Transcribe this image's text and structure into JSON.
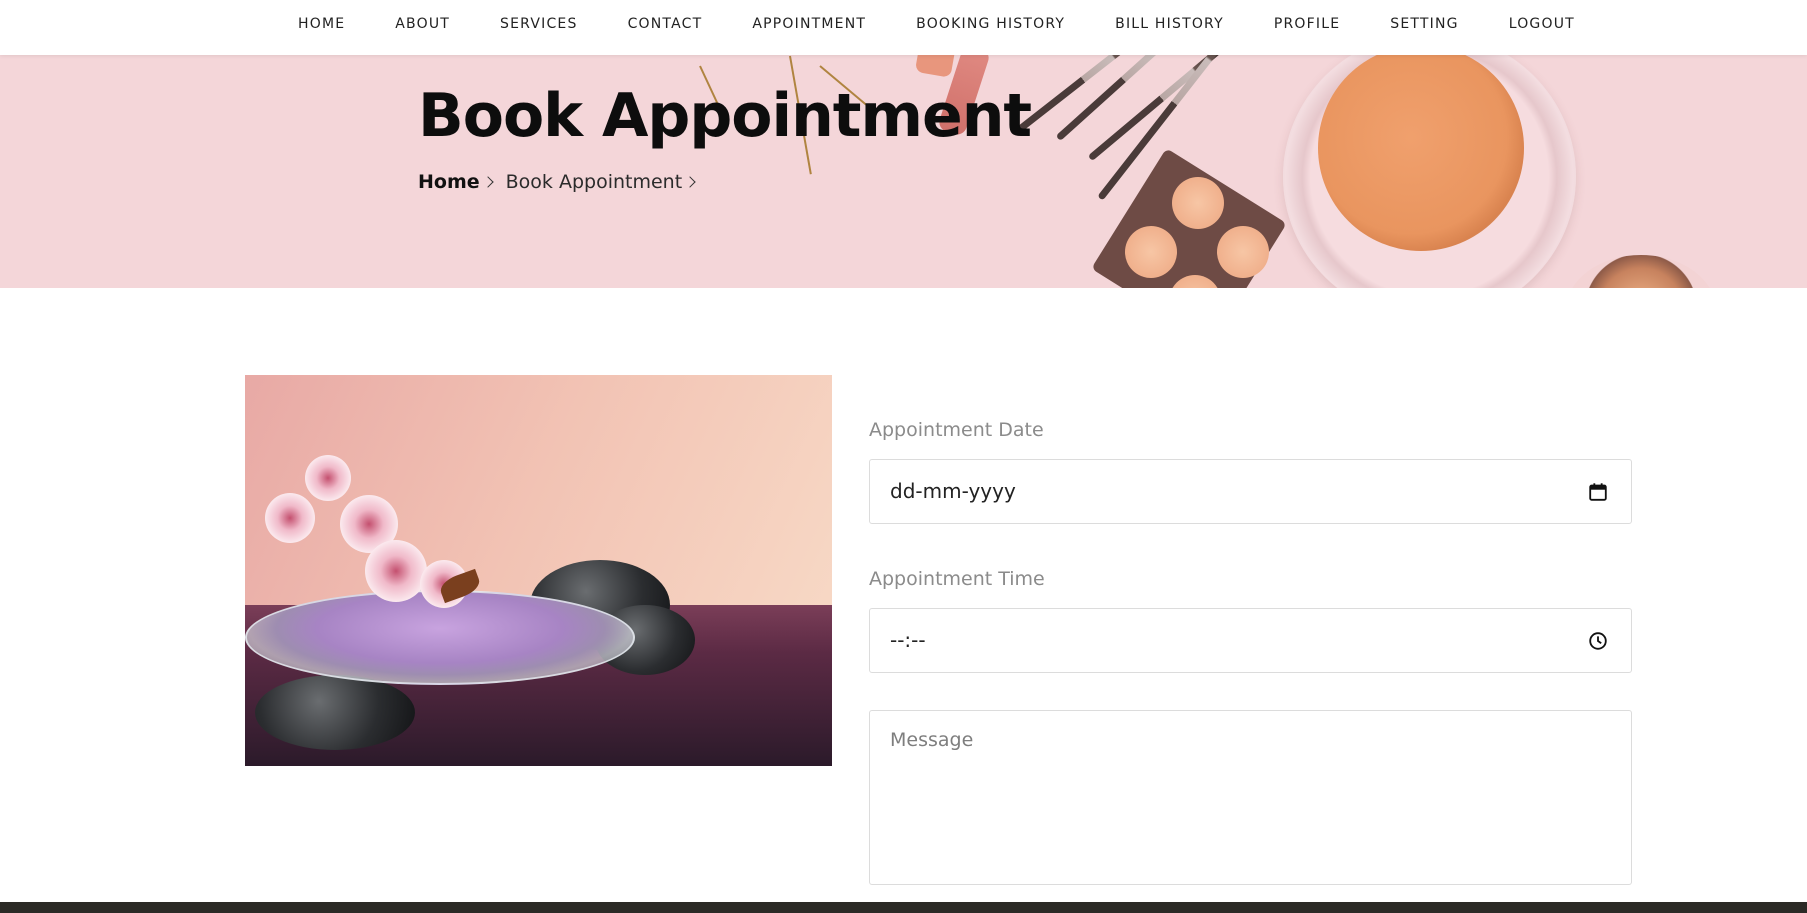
{
  "nav": {
    "items": [
      {
        "label": "HOME"
      },
      {
        "label": "ABOUT"
      },
      {
        "label": "SERVICES"
      },
      {
        "label": "CONTACT"
      },
      {
        "label": "APPOINTMENT"
      },
      {
        "label": "BOOKING HISTORY"
      },
      {
        "label": "BILL HISTORY"
      },
      {
        "label": "PROFILE"
      },
      {
        "label": "SETTING"
      },
      {
        "label": "LOGOUT"
      }
    ]
  },
  "hero": {
    "title": "Book Appointment",
    "breadcrumb": {
      "home": "Home",
      "current": "Book Appointment"
    }
  },
  "form": {
    "date": {
      "label": "Appointment Date",
      "value": "dd-mm-yyyy",
      "icon": "calendar-icon"
    },
    "time": {
      "label": "Appointment Time",
      "value": "--:--",
      "icon": "clock-icon"
    },
    "message": {
      "placeholder": "Message"
    }
  },
  "colors": {
    "hero_bg": "#f4d6d9",
    "label_gray": "#8b8b8b",
    "border": "#dcdcdc"
  }
}
